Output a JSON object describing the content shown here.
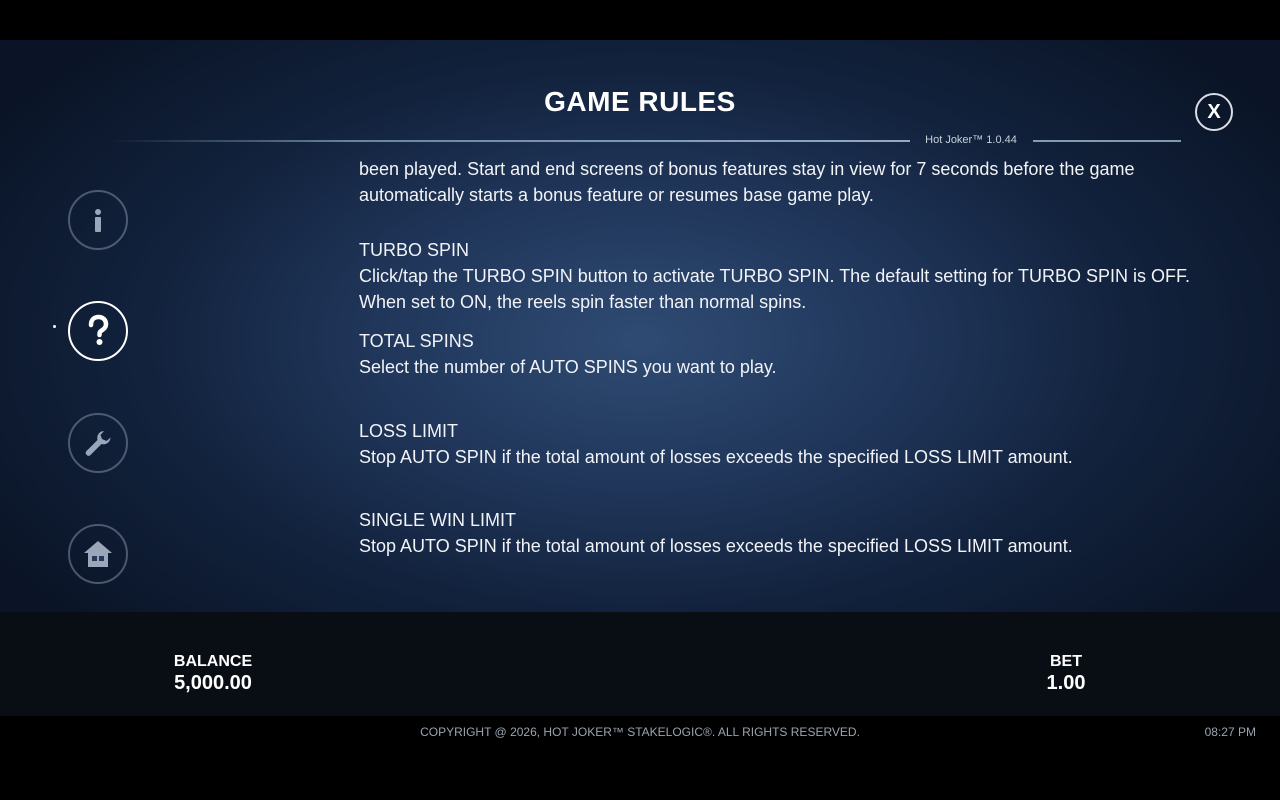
{
  "header": {
    "title": "GAME RULES",
    "version": "Hot Joker™ 1.0.44",
    "close_label": "X"
  },
  "sidebar": {
    "items": [
      {
        "name": "info",
        "icon": "info-icon"
      },
      {
        "name": "help",
        "icon": "question-icon",
        "active": true
      },
      {
        "name": "settings",
        "icon": "wrench-icon"
      },
      {
        "name": "home",
        "icon": "home-icon"
      }
    ]
  },
  "rules": {
    "intro_line1": "been played. Start and end screens of bonus features stay in view for 7 seconds before the game",
    "intro_line2": "automatically starts a bonus feature or resumes base game play.",
    "sections": [
      {
        "title": "TURBO SPIN",
        "line1": "Click/tap the TURBO SPIN button to activate TURBO SPIN. The default setting for TURBO SPIN is OFF.",
        "line2": "When set to ON, the reels spin faster than normal spins."
      },
      {
        "title": "TOTAL SPINS",
        "line1": "Select the number of AUTO SPINS you want to play."
      },
      {
        "title": "LOSS LIMIT",
        "line1": "Stop AUTO SPIN if the total amount of losses exceeds the specified LOSS LIMIT amount."
      },
      {
        "title": "SINGLE WIN LIMIT",
        "line1": "Stop AUTO SPIN if the total amount of losses exceeds the specified LOSS LIMIT amount."
      }
    ]
  },
  "bottom": {
    "balance_label": "BALANCE",
    "balance_value": "5,000.00",
    "bet_label": "BET",
    "bet_value": "1.00"
  },
  "footer": {
    "copyright": "COPYRIGHT @ 2026, HOT JOKER™ STAKELOGIC®. ALL RIGHTS RESERVED.",
    "time": "08:27 PM"
  }
}
